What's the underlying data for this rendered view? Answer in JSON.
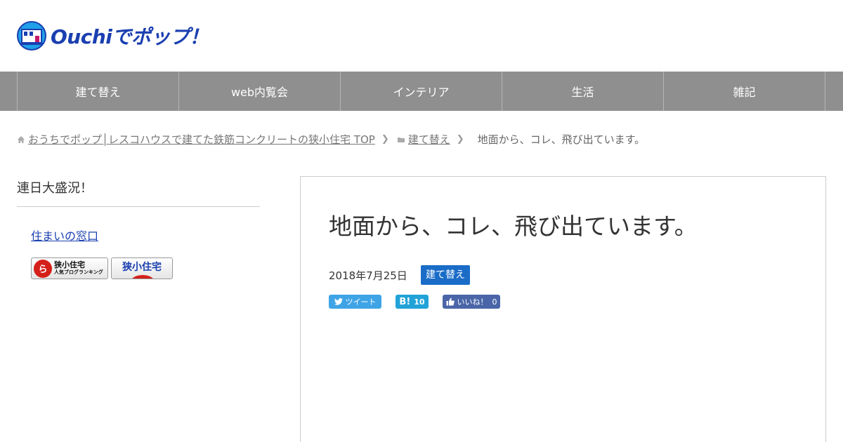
{
  "site": {
    "logo_text": "Ouchiでポップ！"
  },
  "nav": {
    "items": [
      "建て替え",
      "web内覧会",
      "インテリア",
      "生活",
      "雑記"
    ]
  },
  "breadcrumb": {
    "home": "おうちでポップ│レスコハウスで建てた鉄筋コンクリートの狭小住宅 TOP",
    "category": "建て替え",
    "current": "地面から、コレ、飛び出ています。"
  },
  "sidebar": {
    "heading": "連日大盛況！",
    "link": "住まいの窓口",
    "badge1_mark": "ら",
    "badge1_line1": "狭小住宅",
    "badge1_line2": "人気ブログランキング",
    "badge2_text": "狭小住宅"
  },
  "post": {
    "title": "地面から、コレ、飛び出ています。",
    "date": "2018年7月25日",
    "category": "建て替え"
  },
  "share": {
    "tweet_label": "ツイート",
    "hatena_label": "B!",
    "hatena_count": "10",
    "like_label": "いいね！",
    "like_count": "0"
  },
  "colors": {
    "nav_bg": "#8f8f8f",
    "logo_blue": "#1a3fb0",
    "category_blue": "#1a6cc7",
    "twitter": "#3fa4e6",
    "hatena": "#22a3d8",
    "facebook": "#4a66a8"
  },
  "icons": {
    "logo": "house-logo-icon",
    "home": "home-icon",
    "folder": "folder-icon",
    "chevron": "chevron-right-icon",
    "twitter": "twitter-bird-icon",
    "like": "thumbs-up-icon"
  }
}
